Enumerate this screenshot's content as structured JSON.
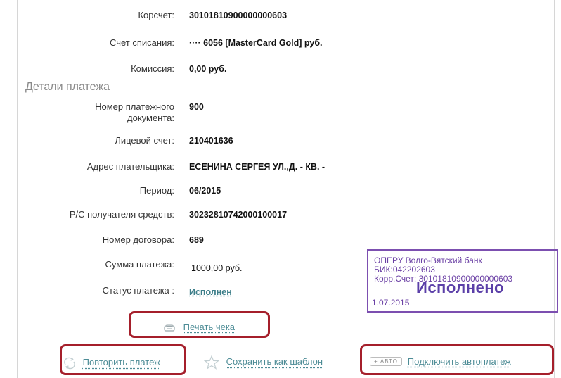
{
  "details": {
    "corr_account_label": "Корсчет:",
    "corr_account_value": "30101810900000000603",
    "debit_account_label": "Счет списания:",
    "debit_account_value": "···· 6056  [MasterCard Gold]  руб.",
    "commission_label": "Комиссия:",
    "commission_value": "0,00 руб."
  },
  "payment_details": {
    "section_title": "Детали платежа",
    "doc_number_label_line1": "Номер платежного",
    "doc_number_label_line2": "документа:",
    "doc_number_value": "900",
    "personal_account_label": "Лицевой счет:",
    "personal_account_value": "210401636",
    "payer_address_label": "Адрес плательщика:",
    "payer_address_value": "ЕСЕНИНА СЕРГЕЯ УЛ.,Д.  -  КВ.  -",
    "period_label": "Период:",
    "period_value": "06/2015",
    "recipient_account_label": "Р/С получателя средств:",
    "recipient_account_value": "30232810742000100017",
    "contract_number_label": "Номер договора:",
    "contract_number_value": "689",
    "amount_label": "Сумма платежа:",
    "amount_value": "1000,00 руб.",
    "status_label": "Статус платежа :",
    "status_value": "Исполнен"
  },
  "stamp": {
    "bank_name": "ОПЕРУ Волго-Вятский банк",
    "bik": "БИК:042202603",
    "corr_account": "Корр.Счет: 30101810900000000603",
    "status": "Исполнено",
    "date": "1.07.2015",
    "color": "#6a3fa4"
  },
  "actions": {
    "print_receipt": "Печать чека",
    "repeat_payment": "Повторить платеж",
    "save_template": "Сохранить как шаблон",
    "auto_badge": "АВТО",
    "enable_autopay": "Подключить автоплатеж"
  },
  "colors": {
    "highlight_border": "#a51f2b",
    "link": "#4d8c96"
  }
}
